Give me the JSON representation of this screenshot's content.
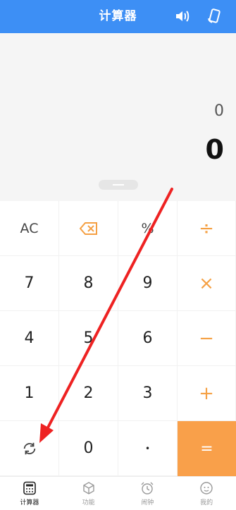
{
  "header": {
    "title": "计算器"
  },
  "display": {
    "expression": "0",
    "result": "0"
  },
  "keypad": {
    "row1": [
      "AC",
      "",
      "%",
      "÷"
    ],
    "row2": [
      "7",
      "8",
      "9",
      "×"
    ],
    "row3": [
      "4",
      "5",
      "6",
      "−"
    ],
    "row4": [
      "1",
      "2",
      "3",
      "+"
    ],
    "row5": [
      "",
      "0",
      "•",
      "="
    ]
  },
  "tabs": [
    {
      "label": "计算器",
      "icon": "calculator-icon",
      "active": true
    },
    {
      "label": "功能",
      "icon": "cube-icon",
      "active": false
    },
    {
      "label": "闹钟",
      "icon": "alarm-clock-icon",
      "active": false
    },
    {
      "label": "我的",
      "icon": "profile-face-icon",
      "active": false
    }
  ],
  "colors": {
    "header": "#3d8ff5",
    "operator": "#f5a043",
    "equals": "#f9a04a",
    "annotation": "#ee2222"
  }
}
